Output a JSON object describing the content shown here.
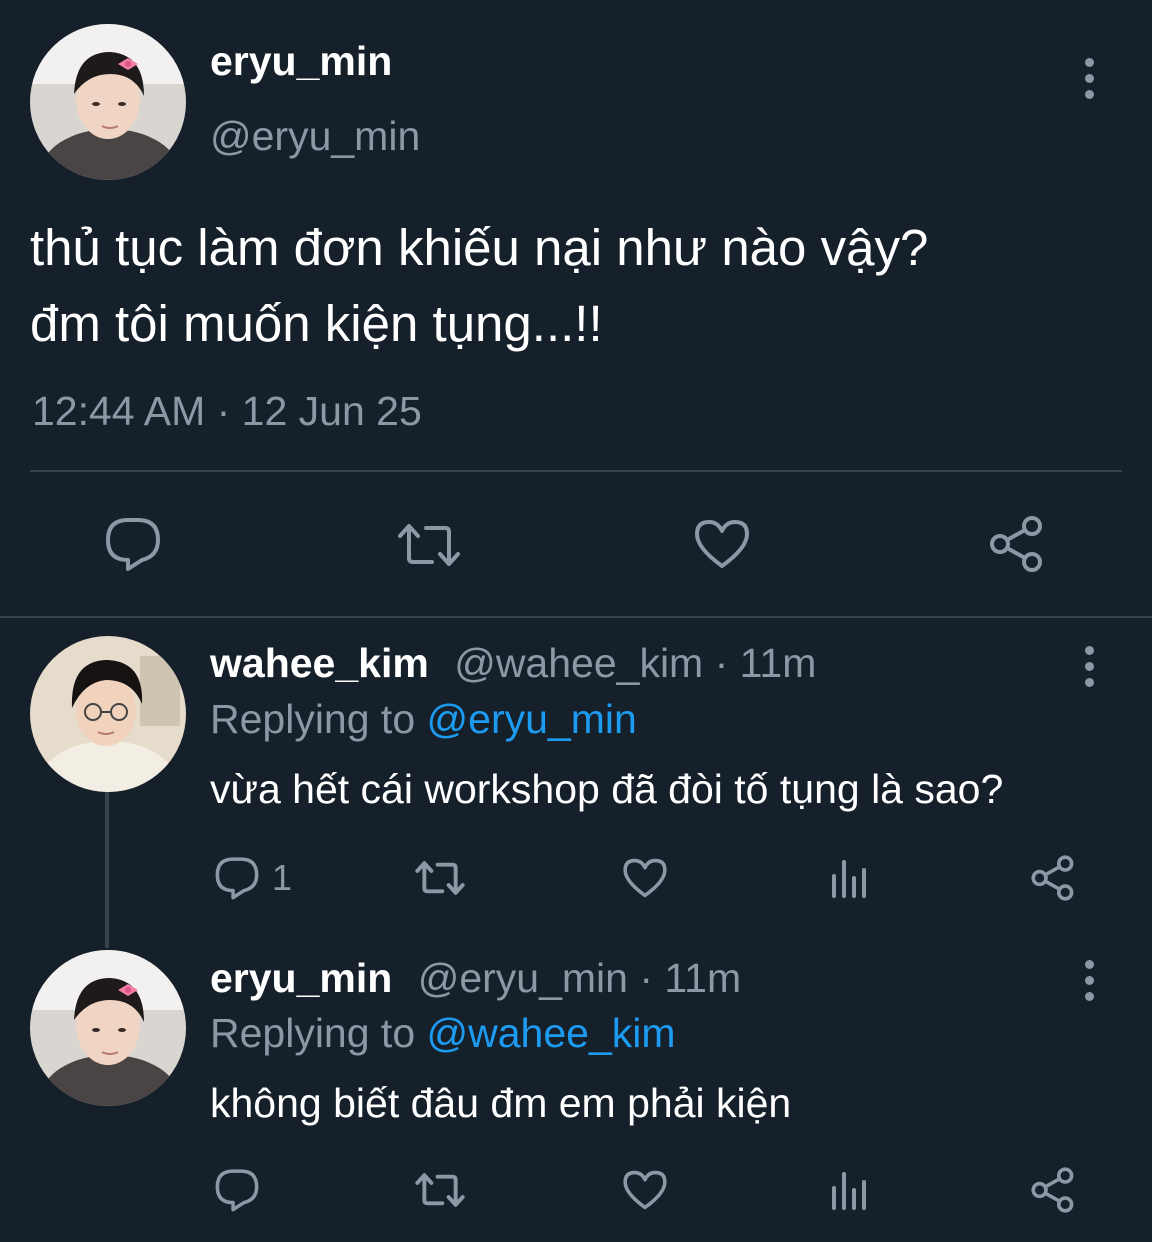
{
  "main_tweet": {
    "display_name": "eryu_min",
    "handle": "@eryu_min",
    "text_line1": "thủ tục làm đơn khiếu nại như nào vậy?",
    "text_line2": "đm tôi muốn kiện tụng...!!",
    "timestamp": "12:44 AM · 12 Jun 25",
    "actions": [
      "reply-icon",
      "retweet-icon",
      "like-icon",
      "share-icon"
    ]
  },
  "replies": [
    {
      "display_name": "wahee_kim",
      "meta": "@wahee_kim · 11m",
      "replying_prefix": "Replying to ",
      "replying_mention": "@eryu_min",
      "text": "vừa hết cái workshop đã đòi tố tụng là sao?",
      "reply_count": "1"
    },
    {
      "display_name": "eryu_min",
      "meta": "@eryu_min · 11m",
      "replying_prefix": "Replying to ",
      "replying_mention": "@wahee_kim",
      "text": "không biết đâu đm em phải kiện",
      "reply_count": ""
    }
  ],
  "colors": {
    "background": "#15202b",
    "secondary_text": "#8b98a5",
    "mention": "#1d9bf0",
    "divider": "#38444d"
  }
}
